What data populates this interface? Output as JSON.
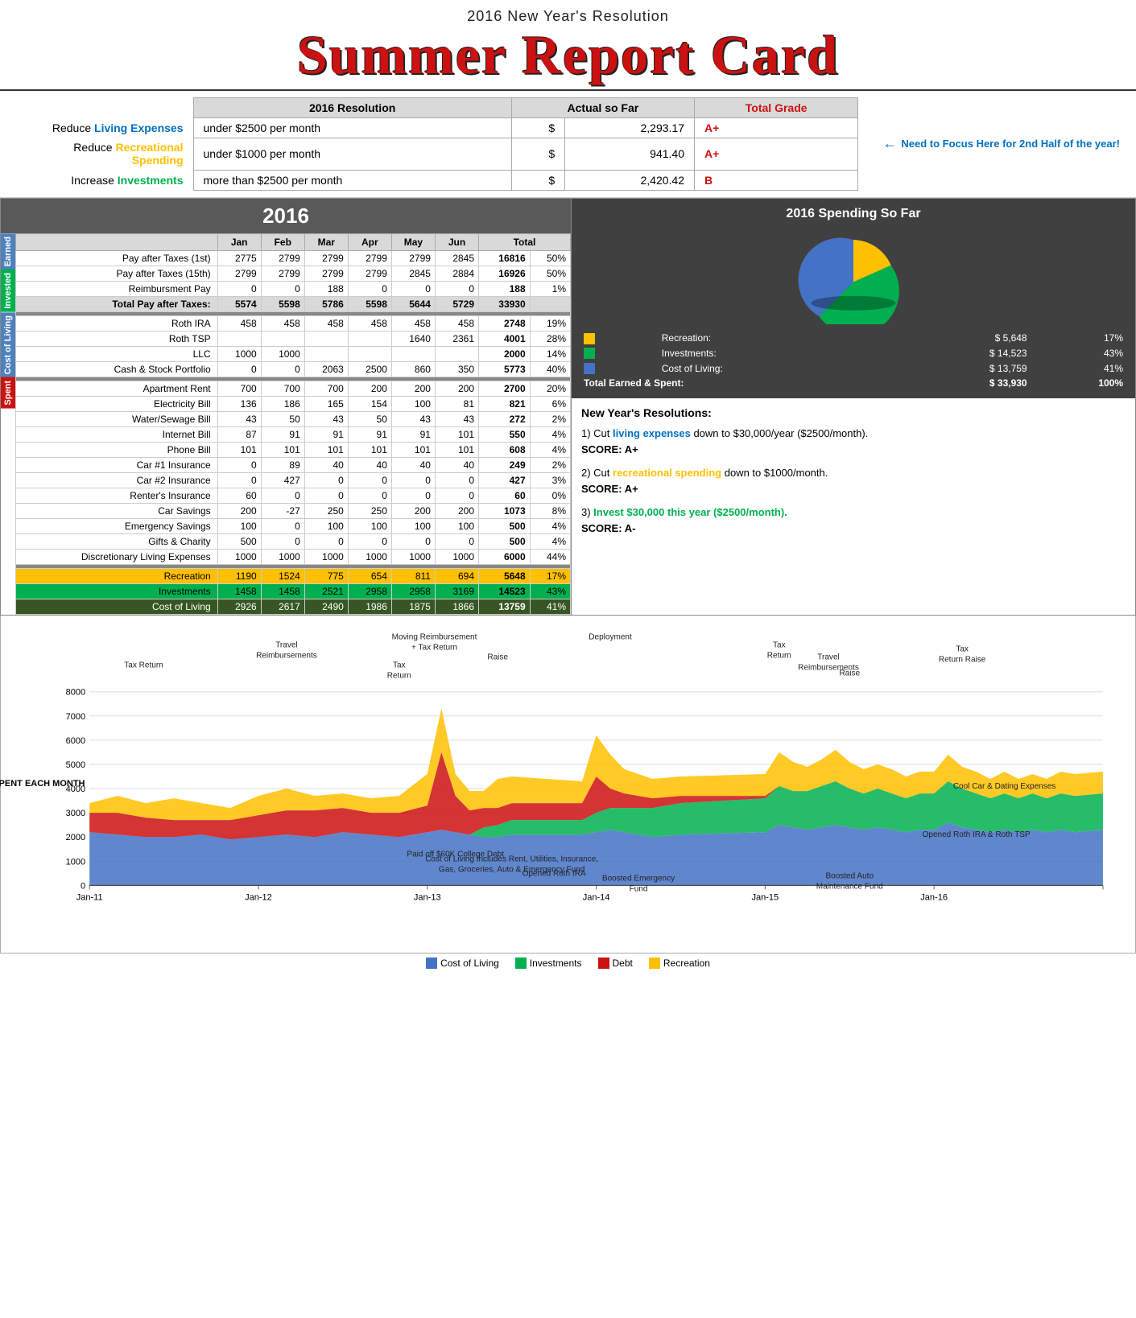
{
  "header": {
    "subtitle": "2016 New Year's Resolution",
    "title": "Summer Report Card"
  },
  "resolution": {
    "col_resolution": "2016 Resolution",
    "col_actual": "Actual so Far",
    "col_grade": "Total Grade",
    "rows": [
      {
        "label_prefix": "Reduce ",
        "label_colored": "Living Expenses",
        "label_color": "#0070c0",
        "resolution": "under $2500 per month",
        "actual": "2,293.17",
        "grade": "A+"
      },
      {
        "label_prefix": "Reduce ",
        "label_colored": "Recreational Spending",
        "label_color": "#ffc000",
        "resolution": "under $1000 per month",
        "actual": "941.40",
        "grade": "A+"
      },
      {
        "label_prefix": "Increase ",
        "label_colored": "Investments",
        "label_color": "#00b050",
        "resolution": "more than $2500 per month",
        "actual": "2,420.42",
        "grade": "B"
      }
    ],
    "focus_note": "Need to Focus Here for 2nd Half of the year!"
  },
  "data_table": {
    "title": "2016",
    "months": [
      "Jan",
      "Feb",
      "Mar",
      "Apr",
      "May",
      "Jun"
    ],
    "col_total": "Total",
    "sections": {
      "earned": {
        "label": "Earned",
        "rows": [
          {
            "label": "Pay after Taxes (1st)",
            "values": [
              2775,
              2799,
              2799,
              2799,
              2799,
              2845
            ],
            "total": 16816,
            "pct": "50%"
          },
          {
            "label": "Pay after Taxes (15th)",
            "values": [
              2799,
              2799,
              2799,
              2799,
              2845,
              2884
            ],
            "total": 16926,
            "pct": "50%"
          },
          {
            "label": "Reimbursment Pay",
            "values": [
              0,
              0,
              188,
              0,
              0,
              0
            ],
            "total": 188,
            "pct": "1%"
          },
          {
            "label": "Total Pay after Taxes:",
            "values": [
              5574,
              5598,
              5786,
              5598,
              5644,
              5729
            ],
            "total": 33930,
            "pct": "",
            "is_total": true
          }
        ]
      },
      "invested": {
        "label": "Invested",
        "rows": [
          {
            "label": "Roth IRA",
            "values": [
              458,
              458,
              458,
              458,
              458,
              458
            ],
            "total": 2748,
            "pct": "19%"
          },
          {
            "label": "Roth TSP",
            "values": [
              "",
              "",
              "",
              "",
              "1640",
              "2361"
            ],
            "total": 4001,
            "pct": "28%"
          },
          {
            "label": "LLC",
            "values": [
              1000,
              1000,
              "",
              "",
              "",
              ""
            ],
            "total": 2000,
            "pct": "14%"
          },
          {
            "label": "Cash & Stock Portfolio",
            "values": [
              0,
              0,
              2063,
              2500,
              860,
              350
            ],
            "total": 5773,
            "pct": "40%"
          }
        ]
      },
      "cost_of_living": {
        "label": "Cost of Living",
        "rows": [
          {
            "label": "Apartment Rent",
            "values": [
              700,
              700,
              700,
              200,
              200,
              200
            ],
            "total": 2700,
            "pct": "20%"
          },
          {
            "label": "Electricity Bill",
            "values": [
              136,
              186,
              165,
              154,
              100,
              81
            ],
            "total": 821,
            "pct": "6%"
          },
          {
            "label": "Water/Sewage Bill",
            "values": [
              43,
              50,
              43,
              50,
              43,
              43
            ],
            "total": 272,
            "pct": "2%"
          },
          {
            "label": "Internet Bill",
            "values": [
              87,
              91,
              91,
              91,
              91,
              101
            ],
            "total": 550,
            "pct": "4%"
          },
          {
            "label": "Phone Bill",
            "values": [
              101,
              101,
              101,
              101,
              101,
              101
            ],
            "total": 608,
            "pct": "4%"
          },
          {
            "label": "Car #1 Insurance",
            "values": [
              0,
              89,
              40,
              40,
              40,
              40
            ],
            "total": 249,
            "pct": "2%"
          },
          {
            "label": "Car #2 Insurance",
            "values": [
              0,
              427,
              0,
              0,
              0,
              0
            ],
            "total": 427,
            "pct": "3%"
          },
          {
            "label": "Renter's Insurance",
            "values": [
              60,
              0,
              0,
              0,
              0,
              0
            ],
            "total": 60,
            "pct": "0%"
          },
          {
            "label": "Car Savings",
            "values": [
              200,
              -27,
              250,
              250,
              200,
              200
            ],
            "total": 1073,
            "pct": "8%"
          },
          {
            "label": "Emergency Savings",
            "values": [
              100,
              0,
              100,
              100,
              100,
              100
            ],
            "total": 500,
            "pct": "4%"
          },
          {
            "label": "Gifts & Charity",
            "values": [
              500,
              0,
              0,
              0,
              0,
              0
            ],
            "total": 500,
            "pct": "4%"
          },
          {
            "label": "Discretionary Living Expenses",
            "values": [
              1000,
              1000,
              1000,
              1000,
              1000,
              1000
            ],
            "total": 6000,
            "pct": "44%"
          }
        ]
      },
      "spent": {
        "label": "Spent",
        "rows": [
          {
            "label": "Recreation",
            "values": [
              1190,
              1524,
              775,
              654,
              811,
              694
            ],
            "total": 5648,
            "pct": "17%",
            "type": "recreation"
          },
          {
            "label": "Investments",
            "values": [
              1458,
              1458,
              2521,
              2958,
              2958,
              3169
            ],
            "total": 14523,
            "pct": "43%",
            "type": "investments"
          },
          {
            "label": "Cost of Living",
            "values": [
              2926,
              2617,
              2490,
              1986,
              1875,
              1866
            ],
            "total": 13759,
            "pct": "41%",
            "type": "cost_living"
          }
        ]
      }
    }
  },
  "pie_chart": {
    "title": "2016 Spending So Far",
    "segments": [
      {
        "label": "Recreation",
        "value": "5,648",
        "pct": "17%",
        "color": "#ffc000"
      },
      {
        "label": "Investments",
        "value": "14,523",
        "pct": "43%",
        "color": "#00b050"
      },
      {
        "label": "Cost of Living",
        "value": "13,759",
        "pct": "41%",
        "color": "#4472c4"
      },
      {
        "label": "Total Earned & Spent",
        "value": "33,930",
        "pct": "100%",
        "color": null
      }
    ]
  },
  "new_year_resolutions": {
    "title": "New Year's Resolutions:",
    "items": [
      {
        "number": "1",
        "text_prefix": "Cut ",
        "text_colored": "living expenses",
        "text_color": "#0070c0",
        "text_suffix": " down to $30,000/year ($2500/month).",
        "score": "SCORE: A+"
      },
      {
        "number": "2",
        "text_prefix": "Cut ",
        "text_colored": "recreational spending",
        "text_color": "#ffc000",
        "text_suffix": " down to $1000/month.",
        "score": "SCORE: A+"
      },
      {
        "number": "3",
        "text_prefix": "Invest $30,000 this year ($2500/month).",
        "text_colored": "",
        "text_color": "#00b050",
        "text_suffix": "",
        "score": "SCORE: A-"
      }
    ]
  },
  "chart": {
    "title": "Area Chart",
    "y_label": "TOTAL CASH SPENT EACH MONTH",
    "x_labels": [
      "Jan-11",
      "Jan-12",
      "Jan-13",
      "Jan-14",
      "Jan-15",
      "Jan-16"
    ],
    "y_labels": [
      "0",
      "1000",
      "2000",
      "3000",
      "4000",
      "5000",
      "6000",
      "7000",
      "8000"
    ],
    "annotations": [
      "Tax Return",
      "Travel Reimbursements",
      "Tax Return",
      "Moving Reimbursement + Tax Return",
      "Raise",
      "Deployment",
      "Paid off $60K College Debt",
      "Opened Roth IRA",
      "Boosted Emergency Fund",
      "Tax Return",
      "Travel Reimbursements",
      "Raise",
      "Boosted Auto Maintenance Fund",
      "Tax Return Raise",
      "Cool Car & Dating Expenses",
      "Opened Roth IRA & Roth TSP"
    ],
    "legend": [
      {
        "label": "Cost of Living",
        "color": "#4472c4"
      },
      {
        "label": "Investments",
        "color": "#00b050"
      },
      {
        "label": "Debt",
        "color": "#cc1111"
      },
      {
        "label": "Recreation",
        "color": "#ffc000"
      }
    ],
    "bottom_note": "Cost of Living Includes Rent, Utilities, Insurance, Gas, Groceries, Auto & Emergency Fund"
  }
}
